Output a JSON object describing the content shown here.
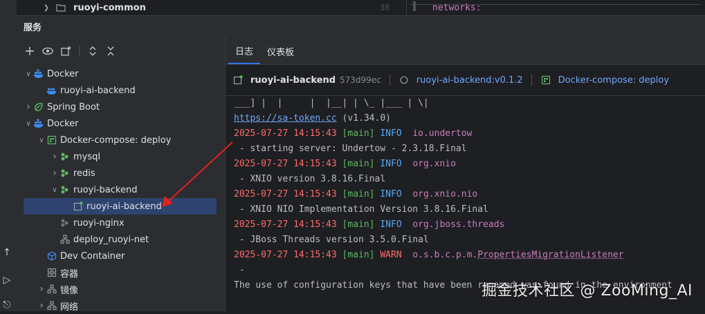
{
  "top": {
    "tree_item": "ruoyi-common",
    "editor_line_number": "38",
    "editor_code": "networks:"
  },
  "services": {
    "title": "服务",
    "tree": [
      {
        "label": "Docker",
        "depth": 0,
        "chevron": "down",
        "icon": "docker-icon"
      },
      {
        "label": "ruoyi-ai-backend",
        "depth": 1,
        "chevron": "",
        "icon": "docker-container-icon"
      },
      {
        "label": "Spring Boot",
        "depth": 0,
        "chevron": "right",
        "icon": "spring-boot-icon"
      },
      {
        "label": "Docker",
        "depth": 0,
        "chevron": "down",
        "icon": "docker-icon"
      },
      {
        "label": "Docker-compose: deploy",
        "depth": 1,
        "chevron": "down",
        "icon": "compose-icon"
      },
      {
        "label": "mysql",
        "depth": 2,
        "chevron": "right",
        "icon": "service-icon"
      },
      {
        "label": "redis",
        "depth": 2,
        "chevron": "right",
        "icon": "service-icon"
      },
      {
        "label": "ruoyi-backend",
        "depth": 2,
        "chevron": "down",
        "icon": "service-icon"
      },
      {
        "label": "ruoyi-ai-backend",
        "depth": 3,
        "chevron": "",
        "icon": "container-running-icon",
        "selected": true
      },
      {
        "label": "ruoyi-nginx",
        "depth": 2,
        "chevron": "",
        "icon": "service-stopped-icon"
      },
      {
        "label": "deploy_ruoyi-net",
        "depth": 2,
        "chevron": "",
        "icon": "network-icon"
      },
      {
        "label": "Dev Container",
        "depth": 1,
        "chevron": "",
        "icon": "dev-container-icon"
      },
      {
        "label": "容器",
        "depth": 1,
        "chevron": "",
        "icon": "containers-icon"
      },
      {
        "label": "镜像",
        "depth": 1,
        "chevron": "right",
        "icon": "images-icon"
      },
      {
        "label": "网络",
        "depth": 1,
        "chevron": "right",
        "icon": "networks-icon"
      }
    ]
  },
  "tabs": [
    {
      "label": "日志",
      "active": true
    },
    {
      "label": "仪表板",
      "active": false
    }
  ],
  "infobar": {
    "name": "ruoyi-ai-backend",
    "hash": "573d99ec",
    "image": "ruoyi-ai-backend:v0.1.2",
    "compose": "Docker-compose: deploy"
  },
  "console": {
    "line1": "___] |  |     |  |__| | \\_ |___ | \\|",
    "link": "https://sa-token.cc",
    "version": " (v1.34.0)",
    "entries": [
      {
        "ts": "2025-07-27 14:15:43",
        "thread": "[main]",
        "level": "INFO ",
        "logger": "io.undertow",
        "msg": " - starting server: Undertow - 2.3.18.Final"
      },
      {
        "ts": "2025-07-27 14:15:43",
        "thread": "[main]",
        "level": "INFO ",
        "logger": "org.xnio",
        "msg": " - XNIO version 3.8.16.Final"
      },
      {
        "ts": "2025-07-27 14:15:43",
        "thread": "[main]",
        "level": "INFO ",
        "logger": "org.xnio.nio",
        "msg": " - XNIO NIO Implementation Version 3.8.16.Final"
      },
      {
        "ts": "2025-07-27 14:15:43",
        "thread": "[main]",
        "level": "INFO ",
        "logger": "org.jboss.threads",
        "msg": " - JBoss Threads version 3.5.0.Final"
      }
    ],
    "warn": {
      "ts": "2025-07-27 14:15:43",
      "thread": "[main]",
      "level": "WARN ",
      "logger_prefix": "o.s.b.c.p.m.",
      "logger_name": "PropertiesMigrationListener"
    },
    "dash": " -",
    "last": "The use of configuration keys that have been renamed was found in the environment"
  },
  "watermark": "掘金技术社区 @ ZooMing_AI",
  "colors": {
    "accent": "#3574f0",
    "selected": "#2e436e",
    "arrow": "#e0241b"
  }
}
